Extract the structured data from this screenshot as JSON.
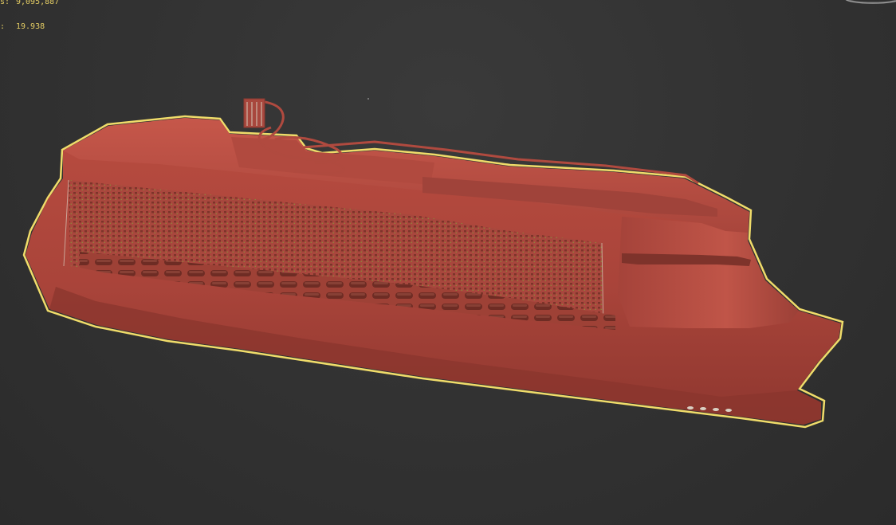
{
  "viewport": {
    "stats": [
      {
        "label": "s:",
        "value": "9,095,887"
      },
      {
        "label": ":",
        "value": "19.938"
      }
    ]
  },
  "colors": {
    "background": "#333333",
    "stats_text": "#e2cb63",
    "model_fill": "#b34a3e",
    "selection_outline": "#f0dc6a"
  },
  "scene": {
    "model": "cruise-ship",
    "selected": true,
    "icons": [
      "viewcube-icon"
    ]
  }
}
